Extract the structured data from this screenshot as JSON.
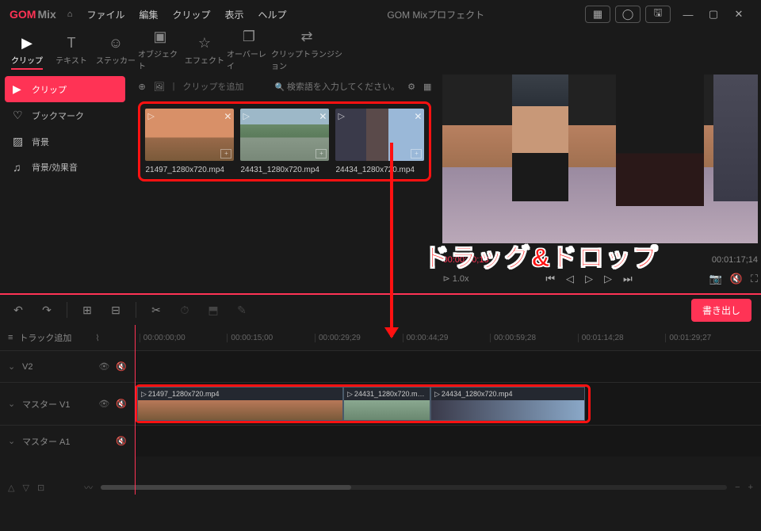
{
  "titlebar": {
    "logo_gom": "GOM",
    "logo_mix": "Mix",
    "menu": {
      "file": "ファイル",
      "edit": "編集",
      "clip": "クリップ",
      "view": "表示",
      "help": "ヘルプ"
    },
    "project_title": "GOM Mixプロフェクト"
  },
  "tooltabs": {
    "clip": "クリップ",
    "text": "テキスト",
    "sticker": "ステッカー",
    "object": "オブジェクト",
    "effect": "エフェクト",
    "overlay": "オーバーレイ",
    "transition": "クリップトランジション"
  },
  "sidebar": {
    "clip": "クリップ",
    "bookmark": "ブックマーク",
    "background": "背景",
    "bgm": "背景/効果音"
  },
  "clips": {
    "add_hint": "クリップを追加",
    "search_placeholder": "検索語を入力してください。",
    "items": [
      {
        "name": "21497_1280x720.mp4"
      },
      {
        "name": "24431_1280x720.mp4"
      },
      {
        "name": "24434_1280x720.mp4"
      }
    ]
  },
  "annotation": {
    "text": "ドラッグ&ドロップ"
  },
  "preview": {
    "current_time": "00:00:00;13",
    "total_time": "00:01:17;14",
    "speed": "1.0x"
  },
  "toolbar": {
    "export": "書き出し"
  },
  "timeline": {
    "add_track": "トラック追加",
    "ruler": [
      "00:00:00;00",
      "00:00:15;00",
      "00:00:29;29",
      "00:00:44;29",
      "00:00:59;28",
      "00:01:14;28",
      "00:01:29;27"
    ],
    "tracks": {
      "v2": "V2",
      "v1": "マスター V1",
      "a1": "マスター A1"
    },
    "clips": [
      {
        "name": "21497_1280x720.mp4"
      },
      {
        "name": "24431_1280x720.m…"
      },
      {
        "name": "24434_1280x720.mp4"
      }
    ]
  }
}
